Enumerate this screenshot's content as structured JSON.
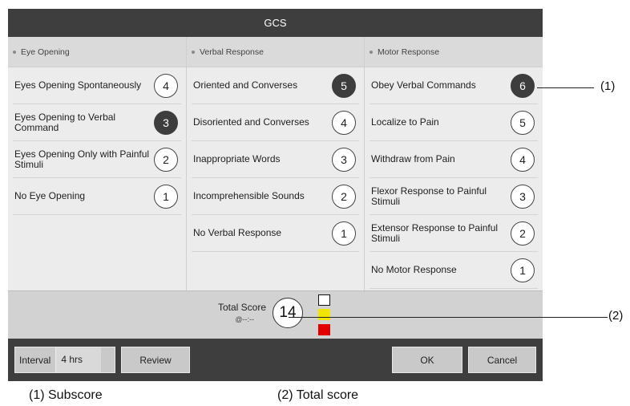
{
  "dialog": {
    "title": "GCS",
    "columns": [
      {
        "header": "Eye Opening",
        "items": [
          {
            "label": "Eyes Opening Spontaneously",
            "score": "4",
            "selected": false
          },
          {
            "label": "Eyes Opening to Verbal Command",
            "score": "3",
            "selected": true
          },
          {
            "label": "Eyes Opening Only with Painful Stimuli",
            "score": "2",
            "selected": false
          },
          {
            "label": "No Eye Opening",
            "score": "1",
            "selected": false
          }
        ]
      },
      {
        "header": "Verbal Response",
        "items": [
          {
            "label": "Oriented and Converses",
            "score": "5",
            "selected": true
          },
          {
            "label": "Disoriented and Converses",
            "score": "4",
            "selected": false
          },
          {
            "label": "Inappropriate Words",
            "score": "3",
            "selected": false
          },
          {
            "label": "Incomprehensible Sounds",
            "score": "2",
            "selected": false
          },
          {
            "label": "No Verbal Response",
            "score": "1",
            "selected": false
          }
        ]
      },
      {
        "header": "Motor Response",
        "items": [
          {
            "label": "Obey Verbal Commands",
            "score": "6",
            "selected": true
          },
          {
            "label": "Localize to Pain",
            "score": "5",
            "selected": false
          },
          {
            "label": "Withdraw from Pain",
            "score": "4",
            "selected": false
          },
          {
            "label": "Flexor Response to Painful Stimuli",
            "score": "3",
            "selected": false
          },
          {
            "label": "Extensor Response to Painful Stimuli",
            "score": "2",
            "selected": false
          },
          {
            "label": "No Motor Response",
            "score": "1",
            "selected": false
          }
        ]
      }
    ],
    "total": {
      "label": "Total Score",
      "time": "@--:--",
      "value": "14",
      "indicator_colors": [
        "#ffffff",
        "#f2e600",
        "#e00000"
      ]
    },
    "buttons": {
      "interval_label": "Interval",
      "interval_value": "4 hrs",
      "review": "Review",
      "ok": "OK",
      "cancel": "Cancel"
    }
  },
  "annotations": {
    "callout_1": "(1)",
    "callout_2": "(2)",
    "caption_1": "(1) Subscore",
    "caption_2": "(2) Total score"
  }
}
